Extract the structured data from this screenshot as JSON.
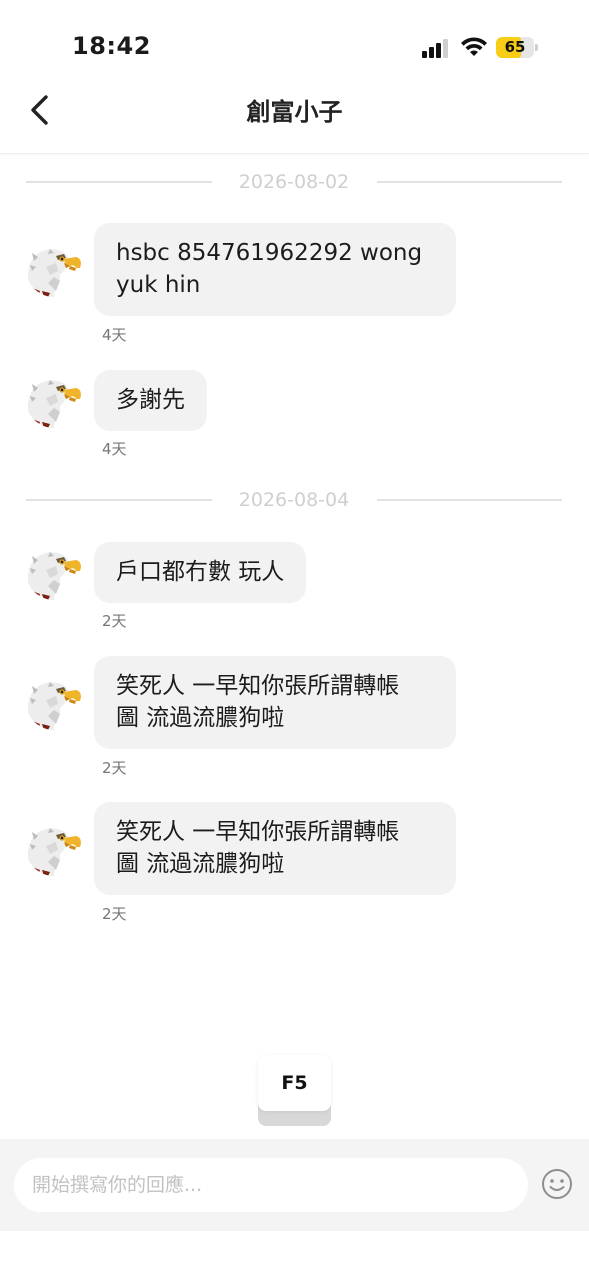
{
  "status_bar": {
    "time": "18:42",
    "battery": "65",
    "battery_level": 0.65
  },
  "header": {
    "title": "創富小子"
  },
  "messages": [
    {
      "date": "2026-08-02"
    },
    {
      "text_line1": "hsbc 854761962292 wong",
      "text_line2": "yuk hin",
      "age": "4天"
    },
    {
      "text": "多謝先",
      "age": "4天"
    },
    {
      "date": "2026-08-04"
    },
    {
      "text": "戶口都冇數 玩人",
      "age": "2天"
    },
    {
      "text_line1": "笑死人 一早知你張所謂轉帳",
      "text_line2": "圖 流過流膿狗啦",
      "age": "2天"
    },
    {
      "text_line1": "笑死人 一早知你張所謂轉帳",
      "text_line2": "圖 流過流膿狗啦",
      "age": "2天"
    }
  ],
  "overlay": {
    "key_label": "F5"
  },
  "composer": {
    "placeholder": "開始撰寫你的回應..."
  },
  "colors": {
    "bubble": "#f2f2f2",
    "battery": "#f7cd16",
    "divider": "#e2e2e2"
  },
  "icons": {
    "back": "chevron-left-icon",
    "signal": "cell-signal-icon",
    "wifi": "wifi-icon",
    "avatar": "eagle-avatar",
    "emoji": "smiley-icon"
  }
}
